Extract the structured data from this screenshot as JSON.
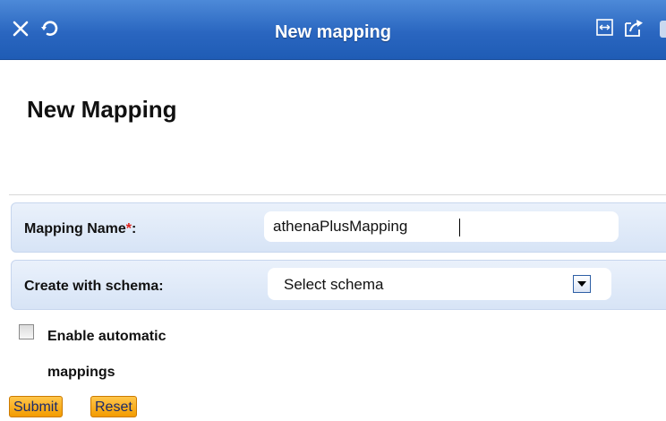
{
  "window": {
    "title": "New mapping",
    "icons": [
      "close-icon",
      "refresh-icon",
      "expand-icon",
      "share-icon"
    ]
  },
  "page": {
    "heading": "New Mapping"
  },
  "form": {
    "mapping_name": {
      "label": "Mapping Name",
      "required_mark": "*",
      "colon": ":",
      "value": "athenaPlusMapping"
    },
    "schema": {
      "label": "Create with schema:",
      "selected": "Select schema"
    },
    "automatic": {
      "label": "Enable automatic mappings",
      "checked": false
    }
  },
  "buttons": {
    "submit": "Submit",
    "reset": "Reset"
  },
  "colors": {
    "titlebar": "#2a66c0",
    "row_bg": "#dbe6f6",
    "button": "#f5a623",
    "required": "#e0221c"
  }
}
